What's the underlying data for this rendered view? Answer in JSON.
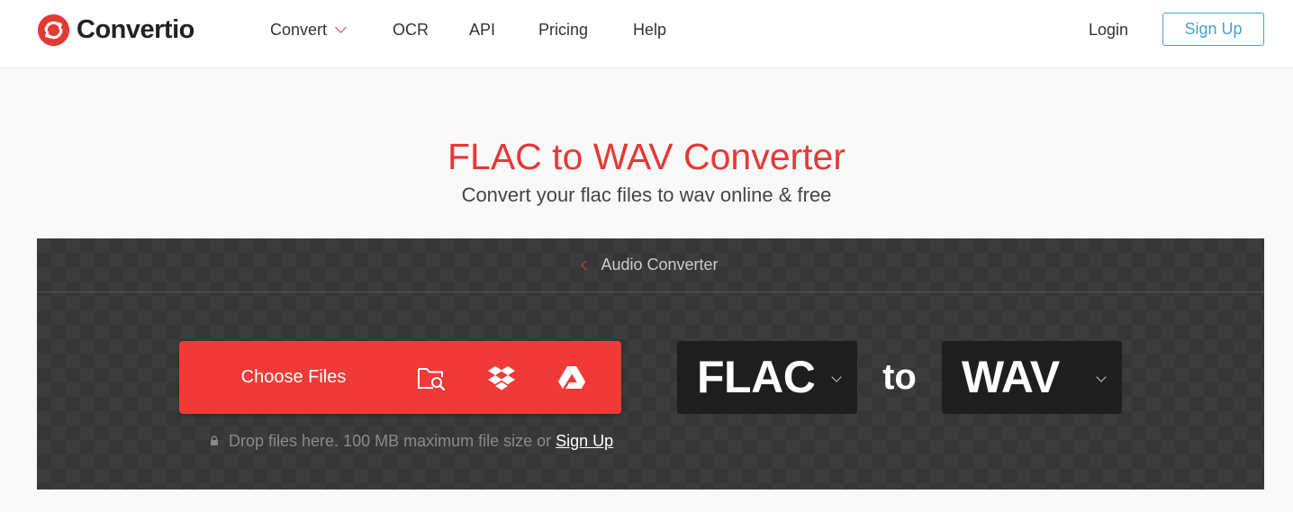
{
  "brand": {
    "name": "Convertio",
    "color": "#e53935"
  },
  "nav": {
    "items": [
      {
        "label": "Convert",
        "has_dropdown": true
      },
      {
        "label": "OCR"
      },
      {
        "label": "API"
      },
      {
        "label": "Pricing"
      },
      {
        "label": "Help"
      }
    ],
    "login_label": "Login",
    "signup_label": "Sign Up"
  },
  "hero": {
    "title": "FLAC to WAV Converter",
    "subtitle": "Convert your flac files to wav online & free"
  },
  "converter": {
    "breadcrumb_label": "Audio Converter",
    "choose_files_label": "Choose Files",
    "sources": [
      "folder-search-icon",
      "dropbox-icon",
      "google-drive-icon"
    ],
    "drop_note": "Drop files here. 100 MB maximum file size or",
    "drop_link": "Sign Up",
    "from_format": "FLAC",
    "to_word": "to",
    "to_format": "WAV"
  }
}
